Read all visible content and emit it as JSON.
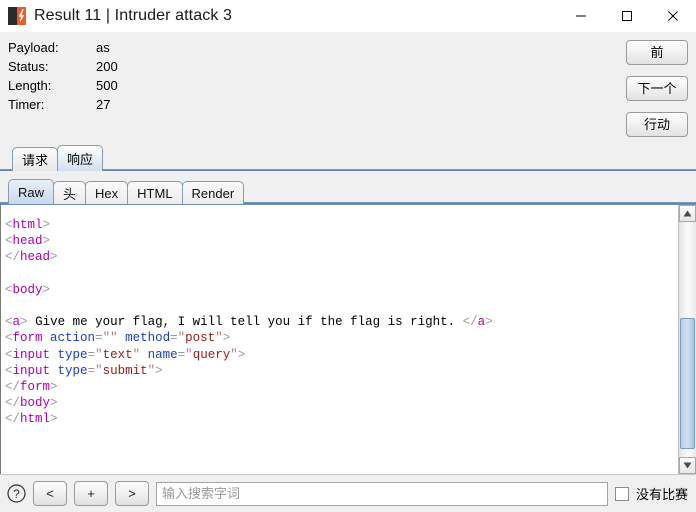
{
  "window": {
    "title": "Result 11 | Intruder attack 3",
    "icon": "burp-suite-icon",
    "controls": {
      "minimize": "minimize-icon",
      "maximize": "maximize-icon",
      "close": "close-icon"
    }
  },
  "result_info": {
    "rows": [
      {
        "label": "Payload:",
        "value": "as"
      },
      {
        "label": "Status:",
        "value": "200"
      },
      {
        "label": "Length:",
        "value": "500"
      },
      {
        "label": "Timer:",
        "value": "27"
      }
    ]
  },
  "action_buttons": {
    "previous": "前",
    "next": "下一个",
    "action": "行动"
  },
  "message_tabs": {
    "items": [
      {
        "label": "请求",
        "active": false
      },
      {
        "label": "响应",
        "active": true
      }
    ]
  },
  "view_tabs": {
    "items": [
      {
        "label": "Raw",
        "active": true
      },
      {
        "label": "头",
        "active": false
      },
      {
        "label": "Hex",
        "active": false
      },
      {
        "label": "HTML",
        "active": false
      },
      {
        "label": "Render",
        "active": false
      }
    ]
  },
  "response_body": {
    "lines": [
      "<html>",
      "<head>",
      "</head>",
      "",
      "<body>",
      "",
      "<a> Give me your flag, I will tell you if the flag is right. </a>",
      "<form action=\"\" method=\"post\">",
      "<input type=\"text\" name=\"query\">",
      "<input type=\"submit\">",
      "</form>",
      "</body>",
      "</html>"
    ],
    "message_text": "Give me your flag, I will tell you if the flag is right.",
    "form_action": "",
    "form_method": "post",
    "input_text_name": "query",
    "colors": {
      "tag": "#b000b0",
      "attribute": "#1a3fd0",
      "value": "#9b1b1b",
      "bracket": "#9a9a9a",
      "text": "#000000"
    }
  },
  "scrollbar": {
    "up_arrow": "scroll-up-icon",
    "down_arrow": "scroll-down-icon",
    "thumb": "scroll-thumb"
  },
  "search_bar": {
    "help": "?",
    "prev_match": "<",
    "add_match": "+",
    "next_match": ">",
    "placeholder": "输入搜索字词",
    "value": "",
    "match_status": "没有比赛"
  },
  "theme": {
    "accent_blue": "#5b7fa6",
    "tab_active": "#c6d9ec",
    "chrome_gray": "#f0f0f0",
    "brand_orange": "#f05a28"
  }
}
